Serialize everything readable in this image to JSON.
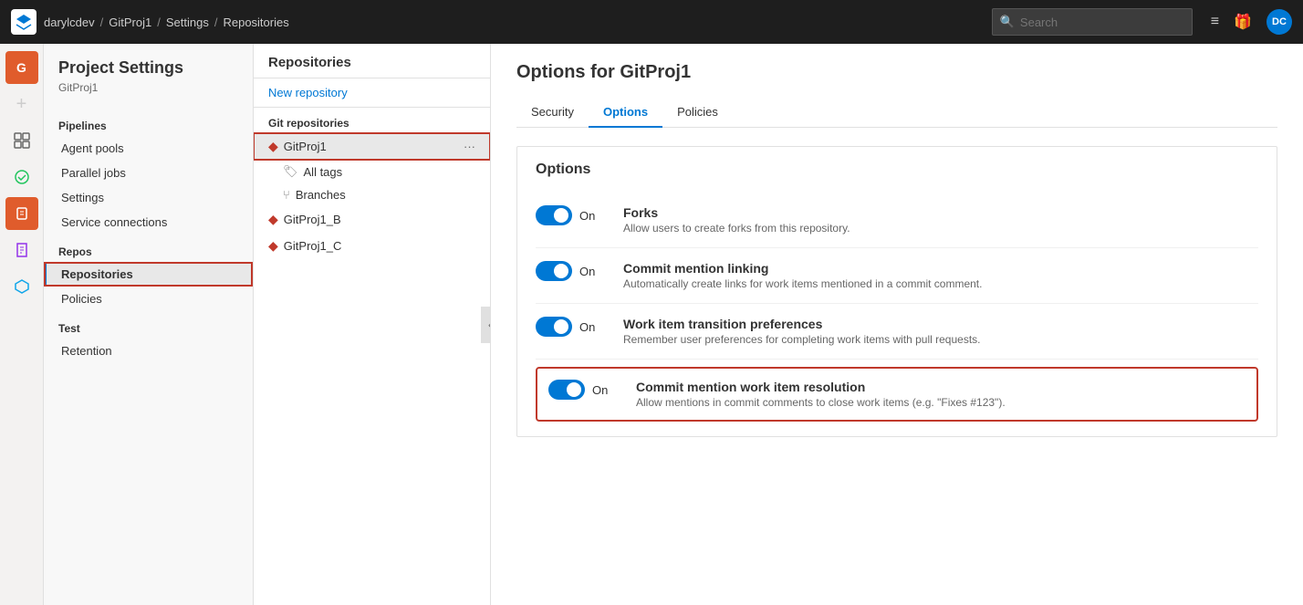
{
  "topbar": {
    "logo": "G",
    "breadcrumb": [
      "darylcdev",
      "/",
      "GitProj1",
      "/",
      "Settings",
      "/",
      "Repositories"
    ],
    "search_placeholder": "Search",
    "icons": [
      "list-icon",
      "gift-icon"
    ],
    "avatar": "DC"
  },
  "rail": {
    "items": [
      {
        "name": "G",
        "type": "avatar"
      },
      {
        "name": "+",
        "type": "icon"
      },
      {
        "name": "📋",
        "type": "icon"
      },
      {
        "name": "✔",
        "type": "icon"
      },
      {
        "name": "🔴",
        "type": "icon"
      },
      {
        "name": "⬡",
        "type": "icon"
      },
      {
        "name": "🧪",
        "type": "icon"
      }
    ]
  },
  "settings": {
    "title": "Project Settings",
    "subtitle": "GitProj1",
    "sections": [
      {
        "label": "Pipelines",
        "items": [
          "Agent pools",
          "Parallel jobs",
          "Settings",
          "Service connections"
        ]
      },
      {
        "label": "Repos",
        "items": [
          "Repositories",
          "Policies"
        ]
      },
      {
        "label": "Test",
        "items": [
          "Retention"
        ]
      }
    ]
  },
  "repos_panel": {
    "title": "Repositories",
    "new_repo": "New repository",
    "git_section": "Git repositories",
    "repos": [
      {
        "name": "GitProj1",
        "active": true,
        "sub_items": [
          {
            "name": "All tags",
            "icon": "tag"
          },
          {
            "name": "Branches",
            "icon": "branch"
          }
        ]
      },
      {
        "name": "GitProj1_B",
        "active": false
      },
      {
        "name": "GitProj1_C",
        "active": false
      }
    ]
  },
  "content": {
    "title": "Options for GitProj1",
    "tabs": [
      "Security",
      "Options",
      "Policies"
    ],
    "active_tab": "Options",
    "options_title": "Options",
    "options": [
      {
        "name": "Forks",
        "desc": "Allow users to create forks from this repository.",
        "on": true,
        "highlighted": false
      },
      {
        "name": "Commit mention linking",
        "desc": "Automatically create links for work items mentioned in a commit comment.",
        "on": true,
        "highlighted": false
      },
      {
        "name": "Work item transition preferences",
        "desc": "Remember user preferences for completing work items with pull requests.",
        "on": true,
        "highlighted": false
      },
      {
        "name": "Commit mention work item resolution",
        "desc": "Allow mentions in commit comments to close work items (e.g. \"Fixes #123\").",
        "on": true,
        "highlighted": true
      }
    ]
  }
}
